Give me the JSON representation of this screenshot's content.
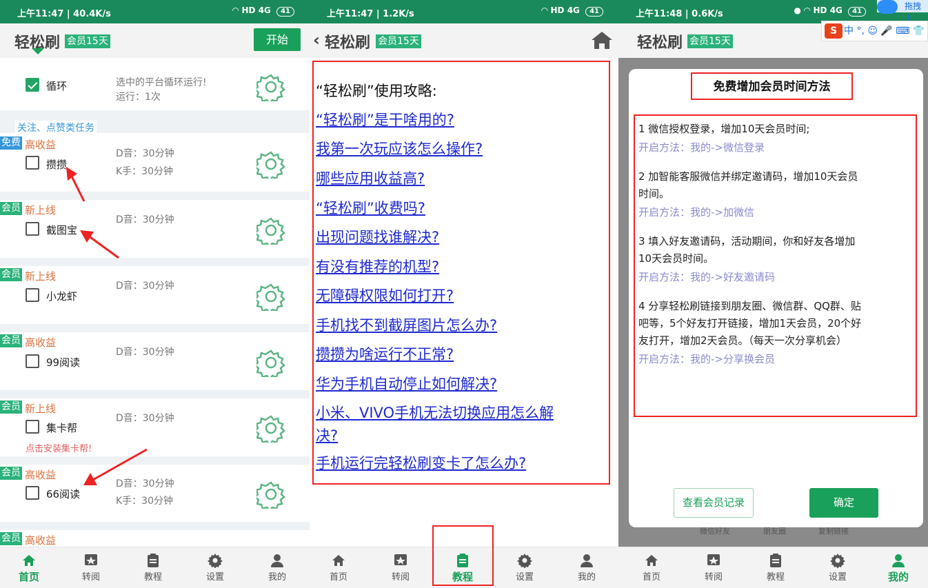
{
  "status": {
    "panel1": {
      "time": "上午11:47 | 40.4K/s",
      "battery": "41"
    },
    "panel2": {
      "time": "上午11:47 | 1.2K/s",
      "battery": "41"
    },
    "panel3": {
      "time": "上午11:48 | 0.6K/s",
      "battery": "41"
    }
  },
  "app": {
    "title": "轻松刷",
    "vip": "会员15天",
    "start": "开始"
  },
  "loop": {
    "label": "循环",
    "desc1": "选中的平台循环运行!",
    "desc2": "运行：1次"
  },
  "section": {
    "label": "关注、点赞类任务"
  },
  "tasks": [
    {
      "tag": "免费",
      "sub": "高收益",
      "name": "攒攒",
      "d1": "D音：30分钟",
      "d2": "K手：30分钟"
    },
    {
      "tag": "会员",
      "sub": "新上线",
      "name": "截图宝",
      "d1": "D音：30分钟",
      "d2": ""
    },
    {
      "tag": "会员",
      "sub": "新上线",
      "name": "小龙虾",
      "d1": "D音：30分钟",
      "d2": ""
    },
    {
      "tag": "会员",
      "sub": "高收益",
      "name": "99阅读",
      "d1": "D音：30分钟",
      "d2": ""
    },
    {
      "tag": "会员",
      "sub": "新上线",
      "name": "集卡帮",
      "d1": "D音：30分钟",
      "d2": ""
    },
    {
      "tag": "会员",
      "sub": "高收益",
      "name": "66阅读",
      "d1": "D音：30分钟",
      "d2": "K手：30分钟"
    },
    {
      "tag": "会员",
      "sub": "高收益",
      "name": "",
      "d1": "",
      "d2": ""
    }
  ],
  "install_hint": "点击安装集卡帮!",
  "nav": [
    {
      "label": "首页"
    },
    {
      "label": "转阅"
    },
    {
      "label": "教程"
    },
    {
      "label": "设置"
    },
    {
      "label": "我的"
    }
  ],
  "guide": {
    "title": "“轻松刷”使用攻略:",
    "links": [
      "“轻松刷”是干啥用的?",
      "我第一次玩应该怎么操作?",
      "哪些应用收益高?",
      "“轻松刷”收费吗?",
      "出现问题找谁解决?",
      "有没有推荐的机型?",
      "无障碍权限如何打开?",
      "手机找不到截屏图片怎么办?",
      "攒攒为啥运行不正常?",
      "华为手机自动停止如何解决?",
      "小米、VIVO手机无法切换应用怎么解",
      "决?",
      "手机运行完轻松刷变卡了怎么办?"
    ]
  },
  "dialog": {
    "title": "免费增加会员时间方法",
    "rules": [
      {
        "text1": "1 微信授权登录，增加10天会员时间;",
        "text2": "",
        "method": "开启方法：我的->微信登录"
      },
      {
        "text1": "2 加智能客服微信并绑定邀请码，增加10天会员",
        "text2": "时间。",
        "method": "开启方法：我的->加微信"
      },
      {
        "text1": "3 填入好友邀请码，活动期间，你和好友各增加",
        "text2": "10天会员时间。",
        "method": "开启方法：我的->好友邀请码"
      },
      {
        "text1": "4 分享轻松刷链接到朋友圈、微信群、QQ群、贴",
        "text2": "吧等，5个好友打开链接，增加1天会员，20个好",
        "text3": "友打开，增加2天会员。（每天一次分享机会）",
        "method": "开启方法：我的->分享换会员"
      }
    ],
    "record_btn": "查看会员记录",
    "ok_btn": "确定",
    "ghost": [
      "微信好友",
      "朋友圈",
      "复制链接"
    ]
  },
  "ime": {
    "s": "S",
    "text": "中 °, ☺ 🎤 ⌨ 👕",
    "drag": "拖拽上"
  },
  "colors": {
    "green": "#19a05a",
    "red_frame": "#e22222",
    "link": "#1e2ad0",
    "free_tag": "#3596d8",
    "vip_tag": "#2ab27a",
    "sub_tag": "#d9703a"
  }
}
